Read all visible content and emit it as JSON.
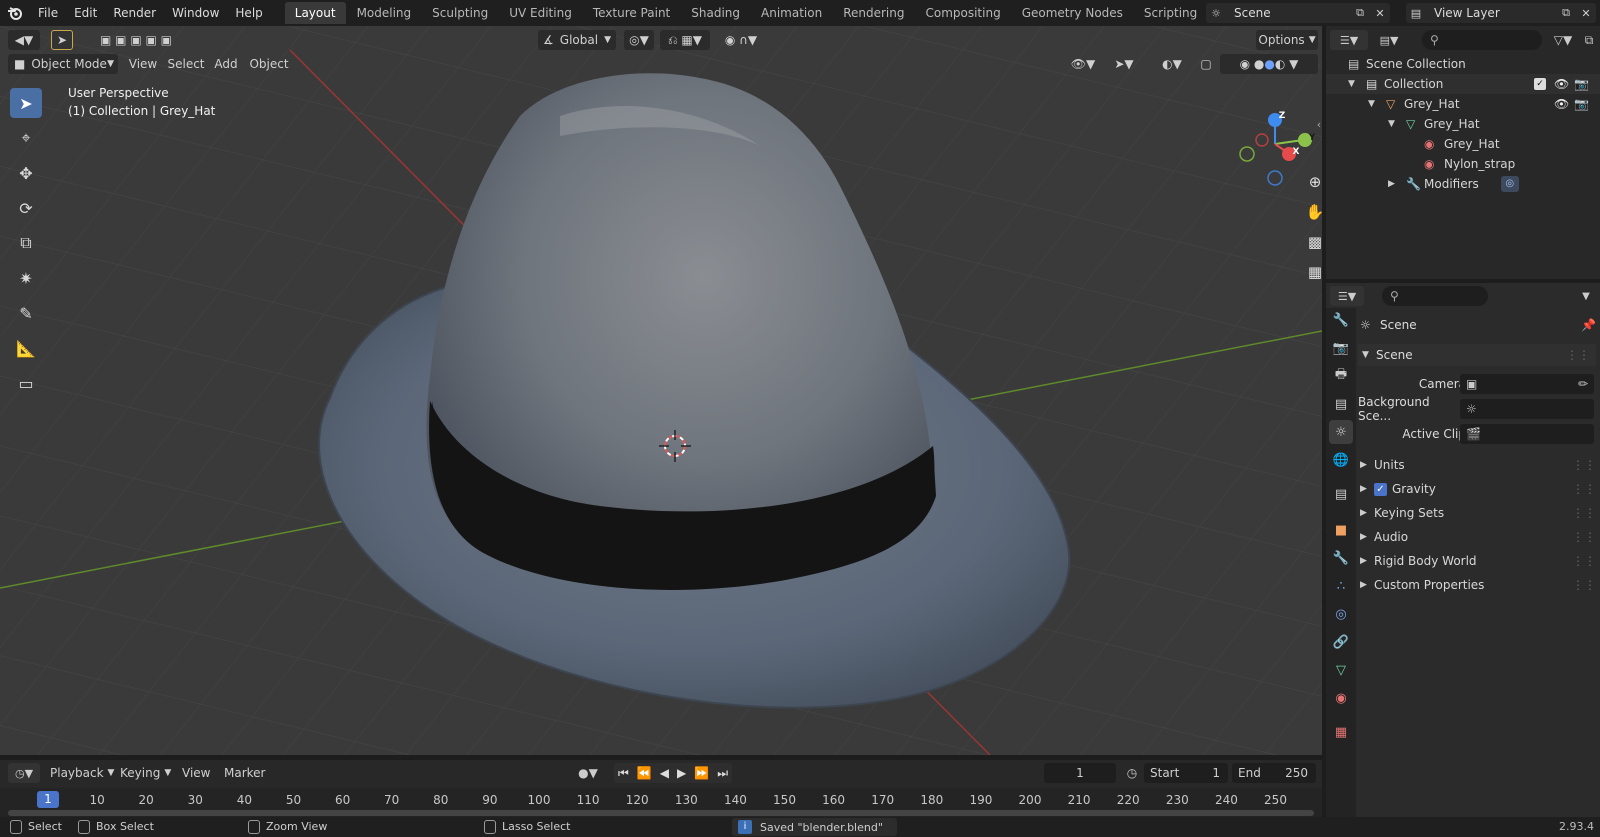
{
  "menubar": {
    "items": [
      "File",
      "Edit",
      "Render",
      "Window",
      "Help"
    ],
    "tabs": [
      "Layout",
      "Modeling",
      "Sculpting",
      "UV Editing",
      "Texture Paint",
      "Shading",
      "Animation",
      "Rendering",
      "Compositing",
      "Geometry Nodes",
      "Scripting"
    ],
    "active_tab": "Layout",
    "scene_name": "Scene",
    "view_layer_name": "View Layer"
  },
  "viewport_header": {
    "transform_orientation": "Global",
    "options_label": "Options",
    "mode": "Object Mode",
    "menu": [
      "View",
      "Select",
      "Add",
      "Object"
    ]
  },
  "viewport": {
    "perspective_label": "User Perspective",
    "context_label": "(1) Collection | Grey_Hat",
    "gizmo": {
      "x": "X",
      "y": "Y",
      "z": "Z"
    }
  },
  "outliner": {
    "rows": [
      {
        "label": "Scene Collection",
        "icon": "scene-collection-icon"
      },
      {
        "label": "Collection",
        "icon": "collection-icon"
      },
      {
        "label": "Grey_Hat",
        "icon": "object-icon"
      },
      {
        "label": "Grey_Hat",
        "icon": "mesh-data-icon"
      },
      {
        "label": "Grey_Hat",
        "icon": "material-icon"
      },
      {
        "label": "Nylon_strap",
        "icon": "material-icon"
      },
      {
        "label": "Modifiers",
        "icon": "wrench-icon"
      }
    ]
  },
  "properties": {
    "context_title": "Scene",
    "panel_title": "Scene",
    "fields": [
      {
        "label": "Camera",
        "value": ""
      },
      {
        "label": "Background Sce...",
        "value": ""
      },
      {
        "label": "Active Clip",
        "value": ""
      }
    ],
    "subpanels": [
      "Units",
      "Gravity",
      "Keying Sets",
      "Audio",
      "Rigid Body World",
      "Custom Properties"
    ],
    "gravity_checked": true
  },
  "timeline": {
    "menu": [
      "Playback",
      "Keying",
      "View",
      "Marker"
    ],
    "current_frame": "1",
    "start_label": "Start",
    "start_value": "1",
    "end_label": "End",
    "end_value": "250",
    "ruler": [
      "1",
      "10",
      "20",
      "30",
      "40",
      "50",
      "60",
      "70",
      "80",
      "90",
      "100",
      "110",
      "120",
      "130",
      "140",
      "150",
      "160",
      "170",
      "180",
      "190",
      "200",
      "210",
      "220",
      "230",
      "240",
      "250"
    ]
  },
  "statusbar": {
    "select": "Select",
    "box_select": "Box Select",
    "zoom_view": "Zoom View",
    "lasso_select": "Lasso Select",
    "message": "Saved \"blender.blend\"",
    "version": "2.93.4"
  },
  "colors": {
    "accent": "#4a74c9",
    "x_axis": "#e54b4b",
    "y_axis": "#8bc34a",
    "z_axis": "#3f8cf0"
  }
}
